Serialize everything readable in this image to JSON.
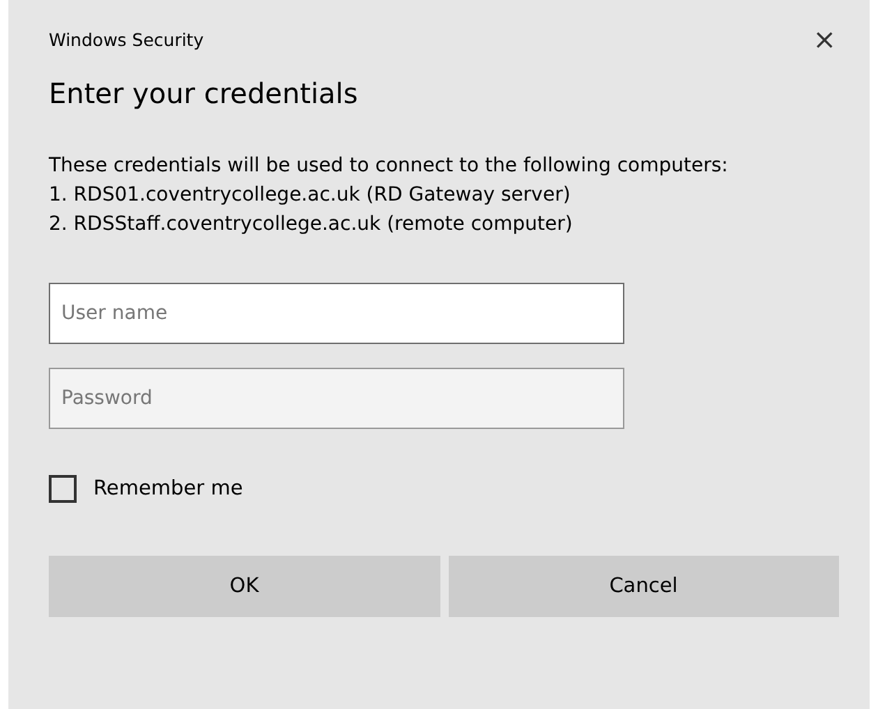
{
  "window": {
    "title": "Windows Security",
    "close": "×"
  },
  "heading": "Enter your credentials",
  "intro": "These credentials will be used to connect to the following computers:",
  "computers": [
    "1. RDS01.coventrycollege.ac.uk (RD Gateway server)",
    "2. RDSStaff.coventrycollege.ac.uk (remote computer)"
  ],
  "fields": [
    {
      "placeholder": "User name",
      "focused": true
    },
    {
      "placeholder": "Password",
      "focused": false
    }
  ],
  "remember": {
    "label": "Remember me",
    "checked": false
  },
  "buttons": [
    "OK",
    "Cancel"
  ]
}
